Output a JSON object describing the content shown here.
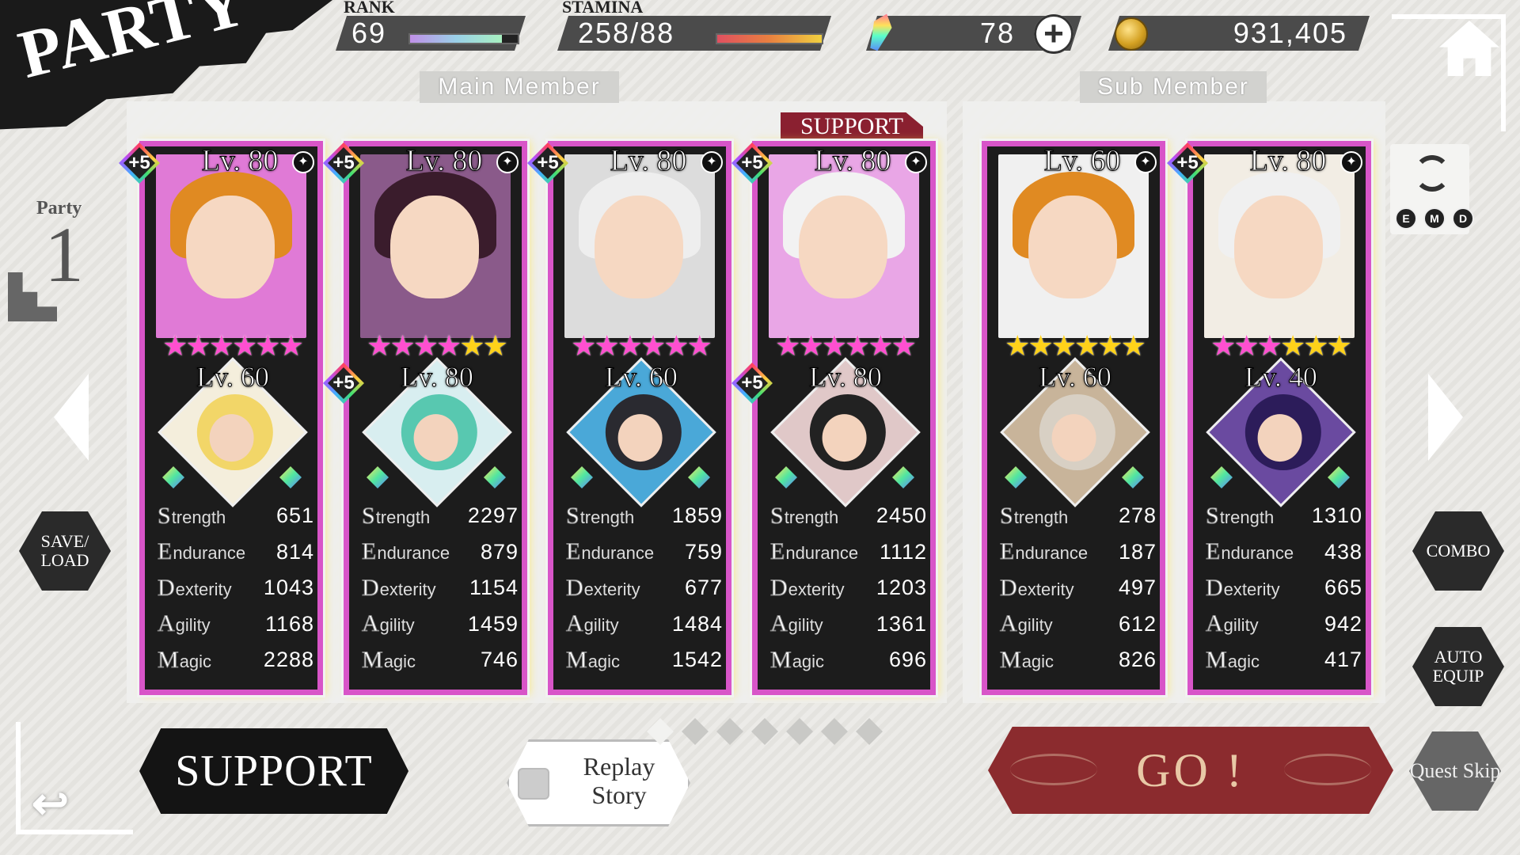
{
  "title": "PARTY",
  "resources": {
    "rank_label": "RANK",
    "rank_value": "69",
    "rank_progress": 0.85,
    "stamina_label": "STAMINA",
    "stamina_value": "258/88",
    "stamina_progress": 1.0,
    "gems": "78",
    "gold": "931,405"
  },
  "sections": {
    "main_label": "Main Member",
    "sub_label": "Sub Member",
    "support_tag": "SUPPORT"
  },
  "party": {
    "label": "Party",
    "number": "1"
  },
  "stat_names": [
    {
      "cap": "S",
      "rest": "trength"
    },
    {
      "cap": "E",
      "rest": "ndurance"
    },
    {
      "cap": "D",
      "rest": "exterity"
    },
    {
      "cap": "A",
      "rest": "gility"
    },
    {
      "cap": "M",
      "rest": "agic"
    }
  ],
  "members": [
    {
      "plus": "+5",
      "level": "Lv. 80",
      "element_icon": "light-element-icon",
      "stars": [
        "pink",
        "pink",
        "pink",
        "pink",
        "pink",
        "pink"
      ],
      "assist_plus": "",
      "assist_level": "Lv. 60",
      "stats": [
        "651",
        "814",
        "1043",
        "1168",
        "2288"
      ],
      "colors": {
        "bg": "#e07ad6",
        "hair": "#e08a22",
        "assist_bg": "#f4eedc",
        "assist_hair": "#f2d668"
      }
    },
    {
      "plus": "+5",
      "level": "Lv. 80",
      "element_icon": "dark-element-icon",
      "stars": [
        "pink",
        "pink",
        "pink",
        "pink",
        "gold",
        "gold"
      ],
      "assist_plus": "+5",
      "assist_level": "Lv. 80",
      "stats": [
        "2297",
        "879",
        "1154",
        "1459",
        "746"
      ],
      "colors": {
        "bg": "#8a5a8a",
        "hair": "#3a1c2c",
        "assist_bg": "#d8eef0",
        "assist_hair": "#58c8b0"
      }
    },
    {
      "plus": "+5",
      "level": "Lv. 80",
      "element_icon": "fire-element-icon",
      "stars": [
        "pink",
        "pink",
        "pink",
        "pink",
        "pink",
        "pink"
      ],
      "assist_plus": "",
      "assist_level": "Lv. 60",
      "stats": [
        "1859",
        "759",
        "677",
        "1484",
        "1542"
      ],
      "colors": {
        "bg": "#dcdcdc",
        "hair": "#eeeeee",
        "assist_bg": "#4aa8d8",
        "assist_hair": "#2a2a30"
      }
    },
    {
      "plus": "+5",
      "level": "Lv. 80",
      "element_icon": "light-element-icon",
      "stars": [
        "pink",
        "pink",
        "pink",
        "pink",
        "pink",
        "pink"
      ],
      "assist_plus": "+5",
      "assist_level": "Lv. 80",
      "stats": [
        "2450",
        "1112",
        "1203",
        "1361",
        "696"
      ],
      "colors": {
        "bg": "#e9a6e6",
        "hair": "#f2f2f2",
        "assist_bg": "#e0c8c8",
        "assist_hair": "#222222"
      }
    },
    {
      "plus": "",
      "level": "Lv. 60",
      "element_icon": "wind-element-icon",
      "stars": [
        "gold",
        "gold",
        "gold",
        "gold",
        "gold",
        "gold"
      ],
      "assist_plus": "",
      "assist_level": "Lv. 60",
      "stats": [
        "278",
        "187",
        "497",
        "612",
        "826"
      ],
      "colors": {
        "bg": "#f0f0f0",
        "hair": "#e08a22",
        "assist_bg": "#c8b49a",
        "assist_hair": "#d8d0c4"
      }
    },
    {
      "plus": "+5",
      "level": "Lv. 80",
      "element_icon": "fire-element-icon",
      "stars": [
        "pink",
        "pink",
        "pink",
        "gold",
        "gold",
        "gold"
      ],
      "assist_plus": "",
      "assist_level": "Lv. 40",
      "stats": [
        "1310",
        "438",
        "665",
        "942",
        "417"
      ],
      "colors": {
        "bg": "#f2ede4",
        "hair": "#f0f0f0",
        "assist_bg": "#6a4aa0",
        "assist_hair": "#2c1c5a"
      }
    }
  ],
  "filter_icons": [
    "E",
    "M",
    "D"
  ],
  "buttons": {
    "save_load": "SAVE/ LOAD",
    "combo": "COMBO",
    "auto_equip": "AUTO EQUIP",
    "quest_skip": "Quest Skip",
    "support": "SUPPORT",
    "replay_story": "Replay Story",
    "go": "GO !"
  },
  "pagination": {
    "count": 7,
    "active": 0
  },
  "colors": {
    "card_border": "#d855c8",
    "go_bg": "#8b2b2e",
    "stamina_gauge": "#e05040",
    "rank_gauge": "#9ad0e8"
  }
}
